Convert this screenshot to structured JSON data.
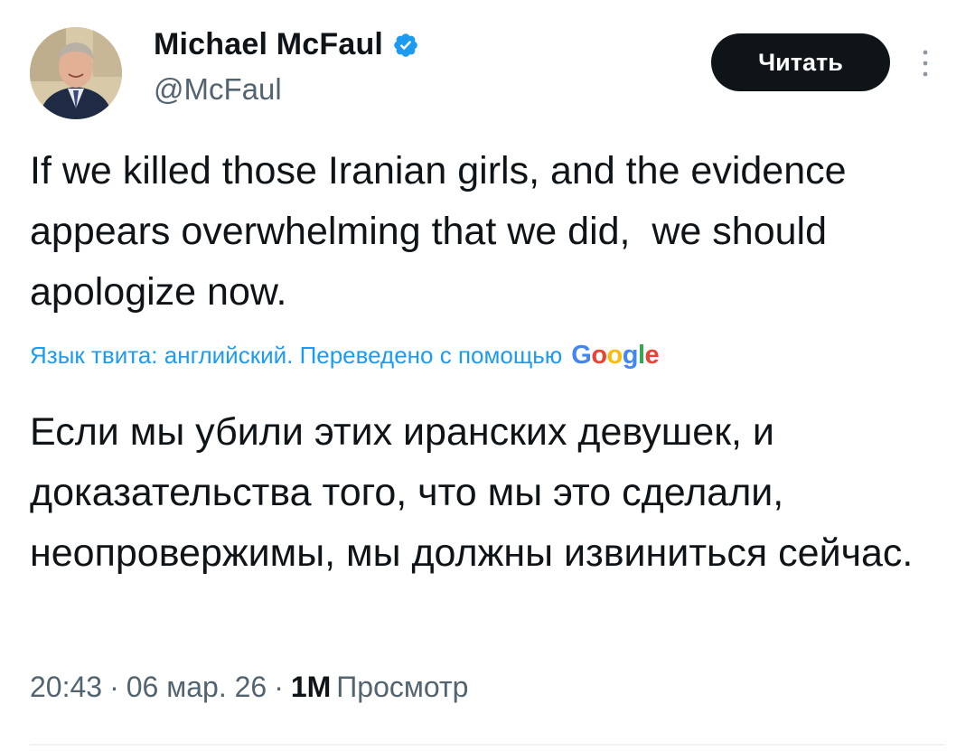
{
  "author": {
    "display_name": "Michael McFaul",
    "handle": "@McFaul",
    "verified": true,
    "verified_icon": "verified-badge-icon",
    "verified_color": "#1d9bf0"
  },
  "follow_button": {
    "label": "Читать"
  },
  "more_button": {
    "icon": "vertical-ellipsis-icon"
  },
  "tweet": {
    "text": "If we killed those Iranian girls, and the evidence appears overwhelming that we did,  we should apologize now.",
    "translation_notice": "Язык твита: английский. Переведено с помощью",
    "translation_provider": "Google",
    "translated_text": "Если мы убили этих иранских девушек, и доказательства того, что мы это сделали, неопровержимы, мы должны извиниться сейчас."
  },
  "meta": {
    "time": "20:43",
    "separator": "·",
    "date": "06 мар. 26",
    "views_count": "1M",
    "views_label": "Просмотр"
  },
  "colors": {
    "text_primary": "#0f1419",
    "text_secondary": "#536471",
    "link": "#1d9bf0",
    "button_bg": "#0f1419"
  }
}
